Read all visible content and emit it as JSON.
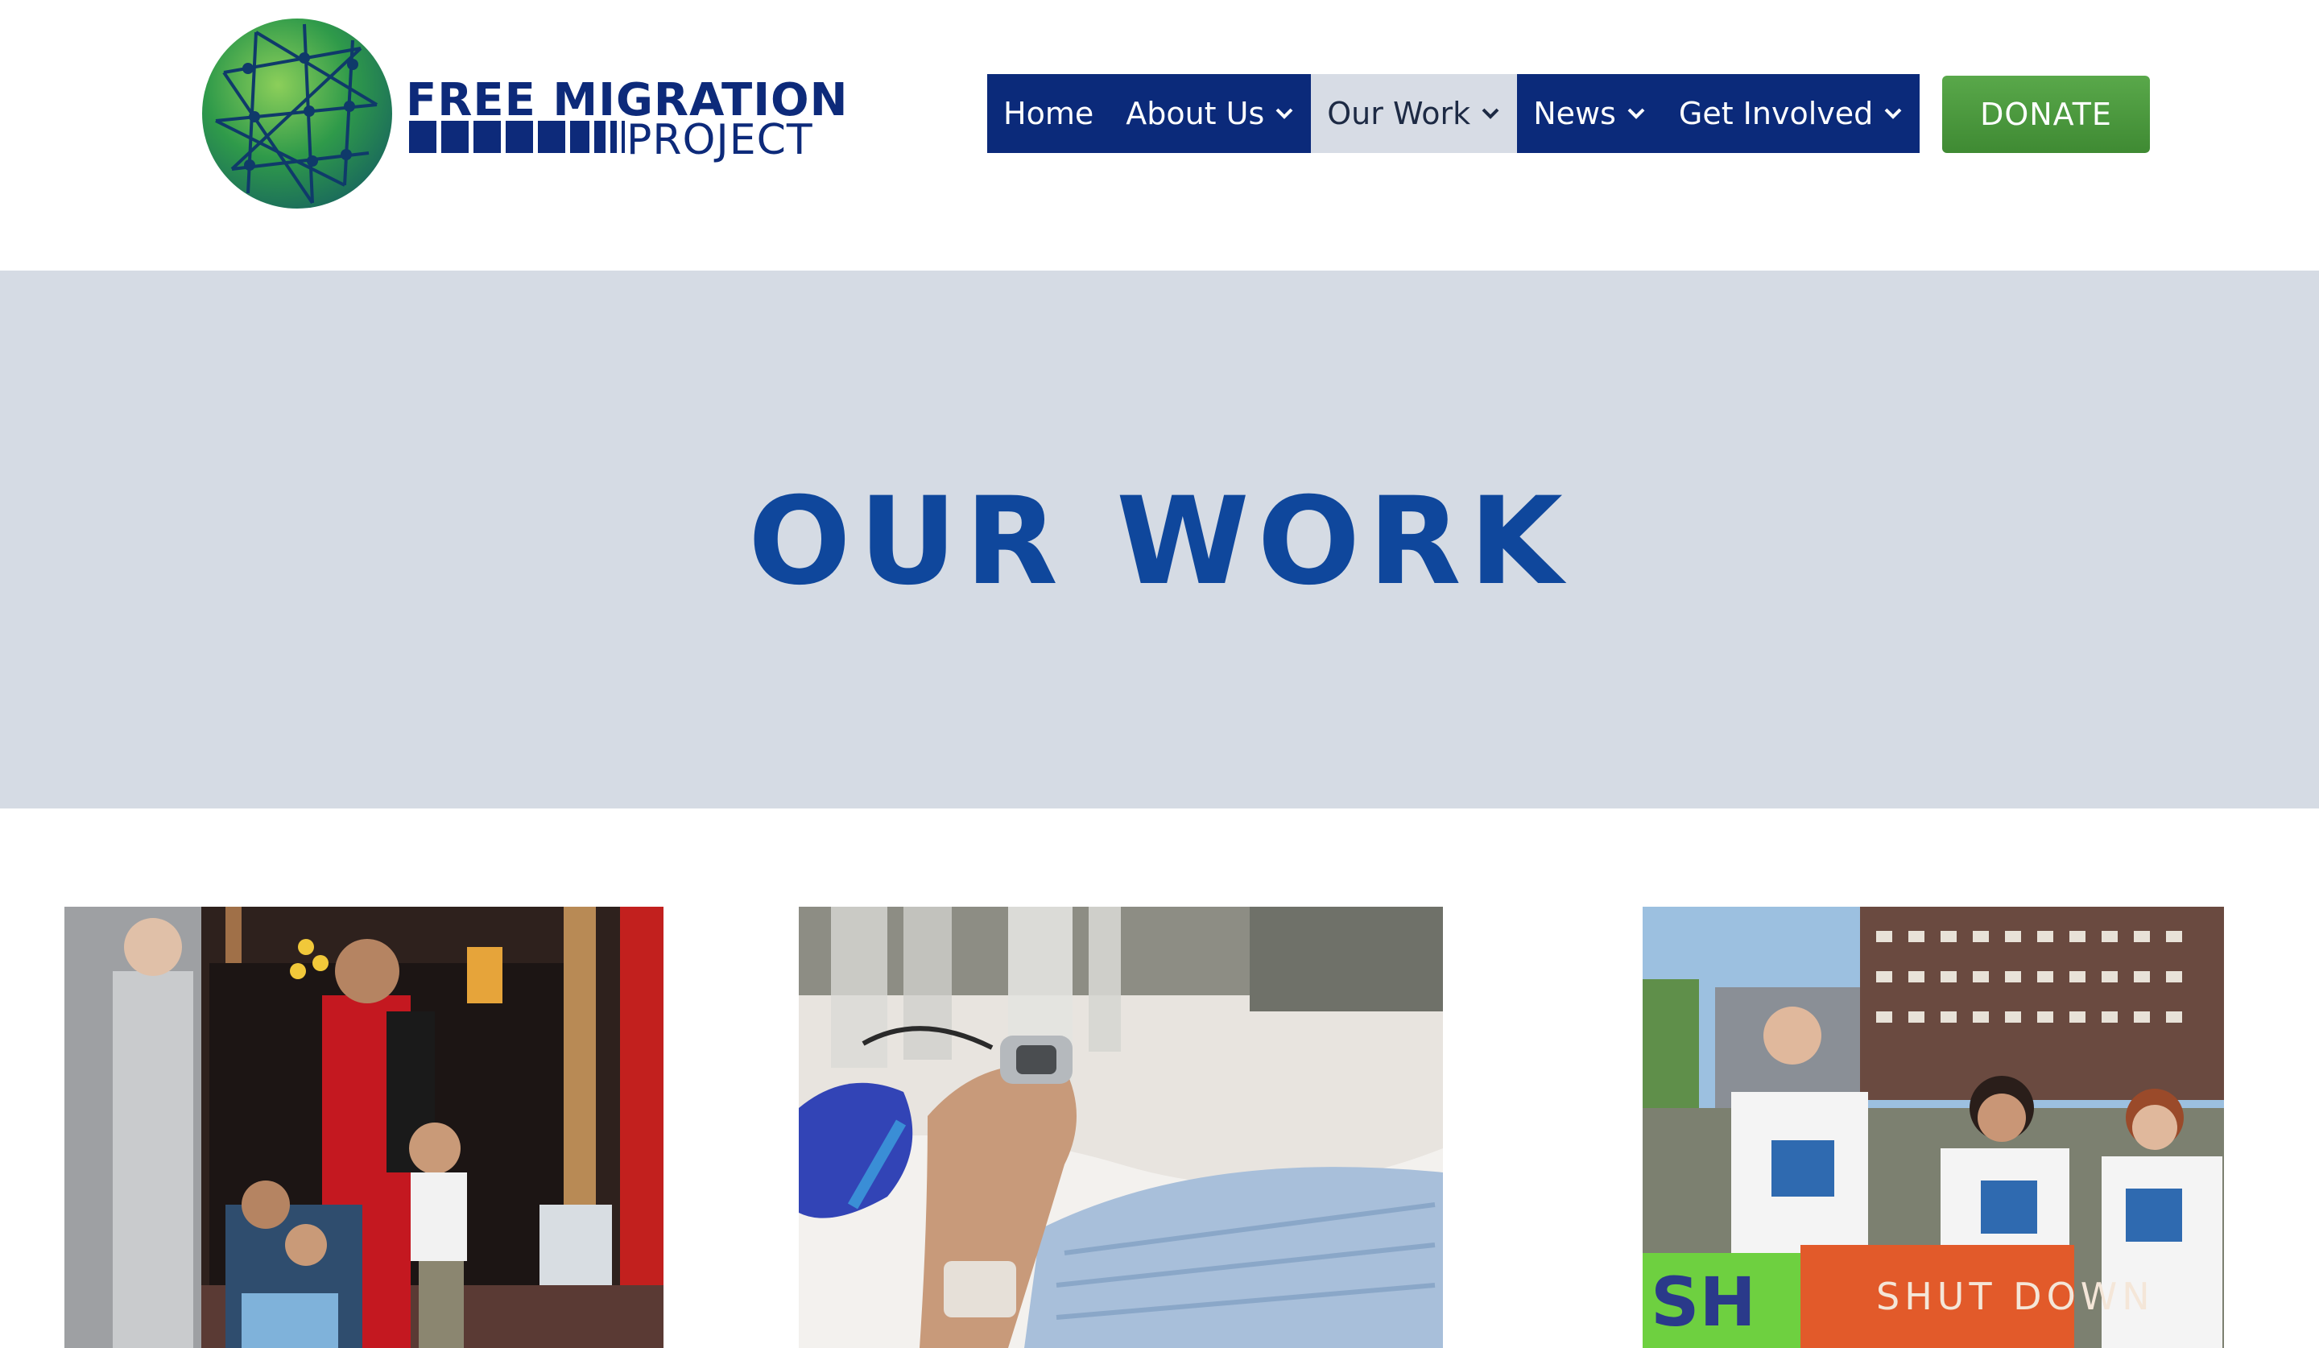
{
  "brand": {
    "line1": "FREE MIGRATION",
    "line2": "PROJECT",
    "colors": {
      "navy": "#0b2a7a",
      "green": "#4a9a3e",
      "heading_blue": "#0f479c",
      "hero_bg": "#d5dbe4"
    }
  },
  "nav": {
    "items": [
      {
        "label": "Home",
        "has_dropdown": false,
        "active": false
      },
      {
        "label": "About Us",
        "has_dropdown": true,
        "active": false
      },
      {
        "label": "Our Work",
        "has_dropdown": true,
        "active": true
      },
      {
        "label": "News",
        "has_dropdown": true,
        "active": false
      },
      {
        "label": "Get Involved",
        "has_dropdown": true,
        "active": false
      }
    ],
    "donate_label": "DONATE"
  },
  "hero": {
    "title": "OUR WORK"
  },
  "cards": [
    {
      "image": "family-at-church-door-photo"
    },
    {
      "image": "hospital-patient-hand-photo"
    },
    {
      "image": "protest-group-shut-down-sign-photo",
      "sign_text": "SHUT DOWN"
    }
  ]
}
